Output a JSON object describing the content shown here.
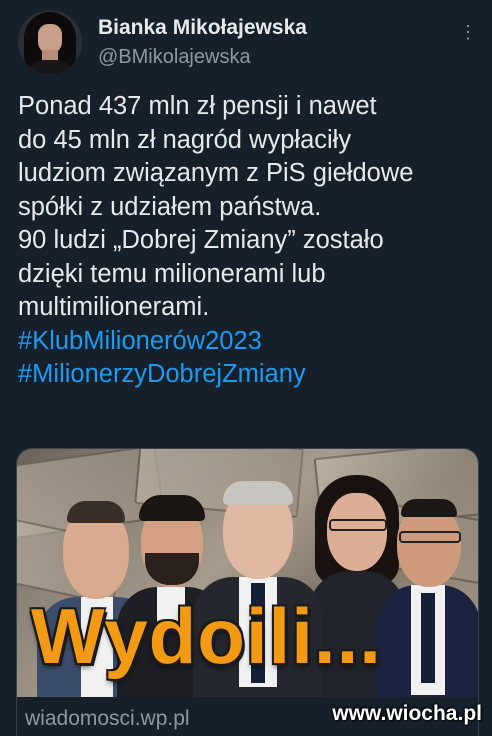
{
  "author": {
    "name": "Bianka Mikołajewska",
    "handle": "@BMikolajewska"
  },
  "more_icon": "more-dots-icon",
  "tweet": {
    "lines": [
      "Ponad 437 mln zł pensji i nawet",
      "do 45 mln zł nagród wypłaciły",
      "ludziom związanym z PiS giełdowe",
      "spółki z udziałem państwa.",
      "90 ludzi „Dobrej Zmiany” zostało",
      "dzięki temu milionerami lub",
      "multimilionerami."
    ],
    "hashtags": [
      "#KlubMilionerów2023",
      "#MilionerzyDobrejZmiany"
    ]
  },
  "card": {
    "headline": "Wydoili...",
    "domain": "wiadomosci.wp.pl"
  },
  "watermark": "www.wiocha.pl",
  "colors": {
    "background": "#15202b",
    "text": "#e7e9ea",
    "secondary": "#8b98a5",
    "hashtag": "#1d9bf0",
    "headline": "#f39a14"
  }
}
